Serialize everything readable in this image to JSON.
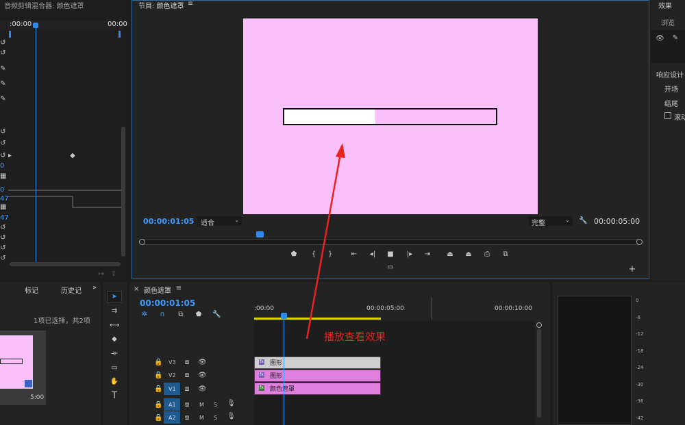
{
  "mixer": {
    "title": "音频剪辑混合器: 颜色遮罩",
    "ruler_start": ":00:00",
    "ruler_end": "00:00",
    "numbers": [
      "0",
      "0",
      "47",
      "47"
    ]
  },
  "program": {
    "title": "节目: 颜色遮罩",
    "timecode": "00:00:01:05",
    "fit_option": "适合",
    "quality_option": "完整",
    "duration": "00:00:05:00",
    "progress_fraction": 0.43
  },
  "effects": {
    "title": "效果",
    "browse": "浏览",
    "section": "响应设计",
    "items": [
      "开场",
      "结尾",
      "滚动"
    ]
  },
  "project": {
    "tabs": [
      "标记",
      "历史记"
    ],
    "selection": "1项已选择，共2项",
    "thumb_duration": "5:00"
  },
  "timeline": {
    "title": "颜色遮罩",
    "timecode": "00:00:01:05",
    "ruler": [
      ":00:00",
      "00:00:05:00",
      "00:00:10:00"
    ],
    "annotation": "播放查看效果",
    "tracks": [
      {
        "name": "V3",
        "clip": "图形",
        "color": "#cfcfcf"
      },
      {
        "name": "V2",
        "clip": "图形",
        "color": "#e07fde"
      },
      {
        "name": "V1",
        "clip": "颜色遮罩",
        "color": "#e07fde"
      },
      {
        "name": "A1",
        "clip": "",
        "color": ""
      },
      {
        "name": "A2",
        "clip": "",
        "color": ""
      }
    ],
    "track_labels": {
      "m": "M",
      "s": "S"
    }
  },
  "meter": {
    "ticks": [
      "0",
      "-6",
      "-12",
      "-18",
      "-24",
      "-30",
      "-36",
      "-42"
    ]
  },
  "colors": {
    "accent": "#2d8ceb",
    "frame_bg": "#f9c0fb",
    "annotation": "#e8231f"
  }
}
